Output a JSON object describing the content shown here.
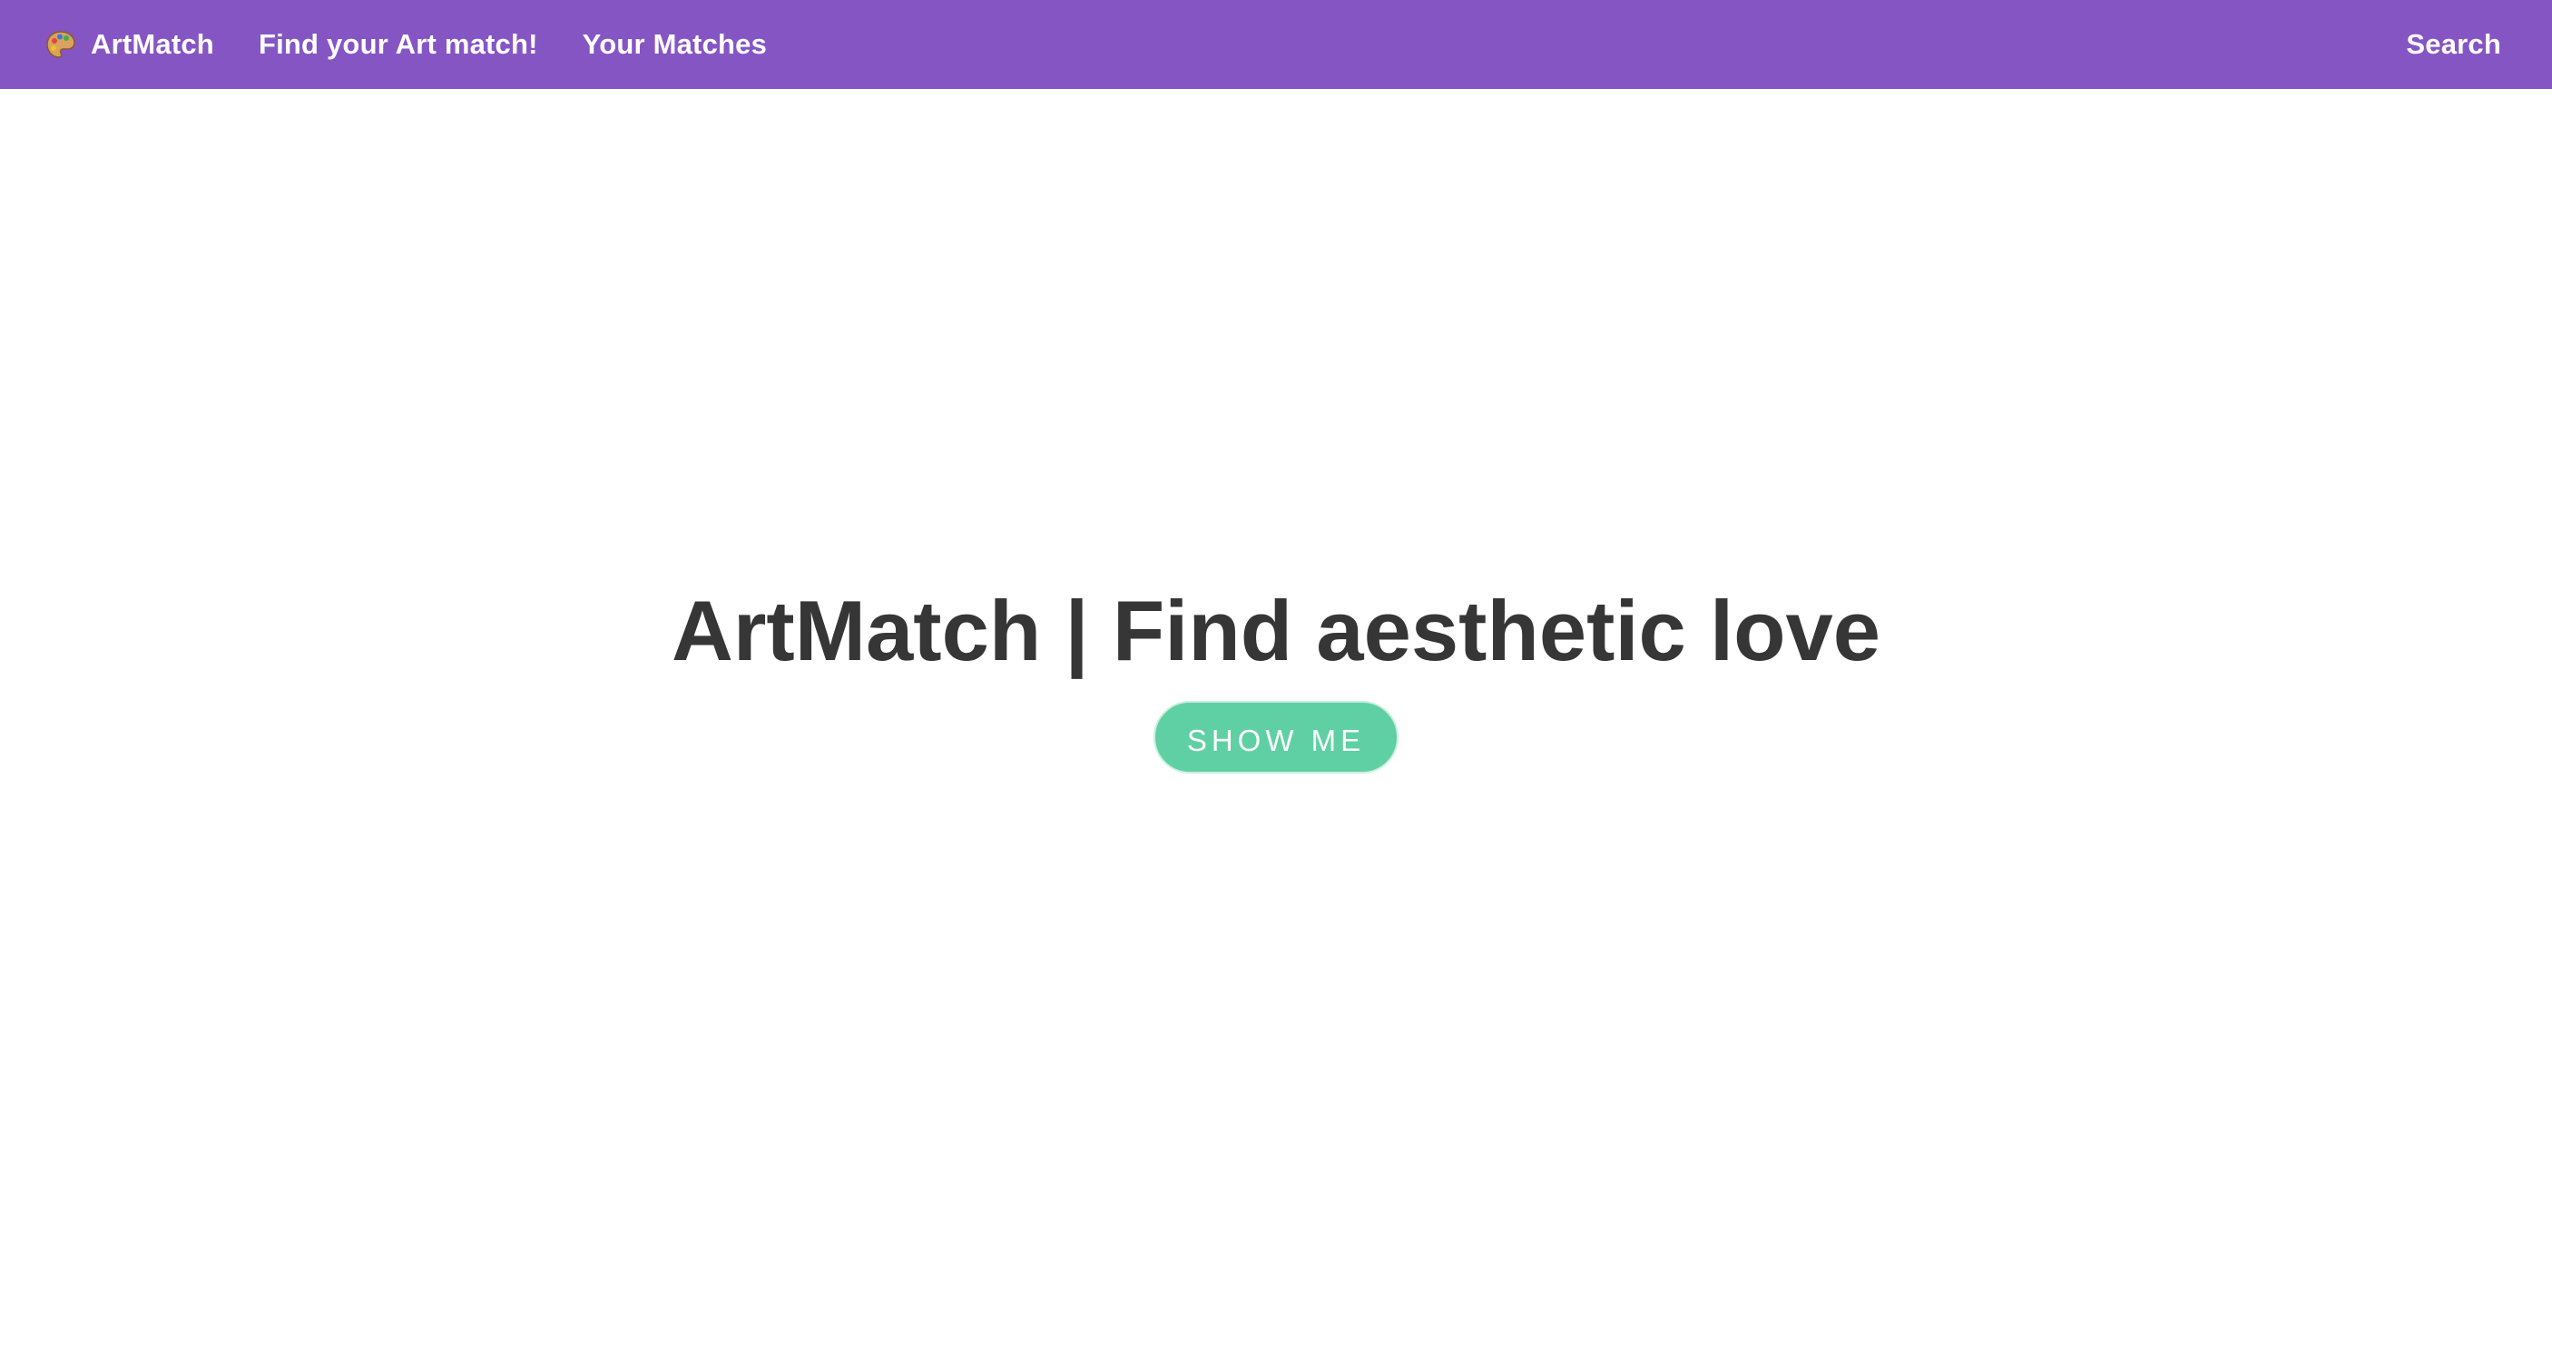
{
  "colors": {
    "navbar_bg": "#8555c4",
    "nav_text": "#ffffff",
    "hero_text": "#363636",
    "button_bg": "#5fd0a3",
    "button_text": "#ffffff"
  },
  "navbar": {
    "brand_icon": "palette-icon",
    "brand_label": "ArtMatch",
    "links": [
      {
        "label": "Find your Art match!"
      },
      {
        "label": "Your Matches"
      }
    ],
    "search_label": "Search"
  },
  "hero": {
    "title": "ArtMatch | Find aesthetic love",
    "button_label": "SHOW ME"
  }
}
